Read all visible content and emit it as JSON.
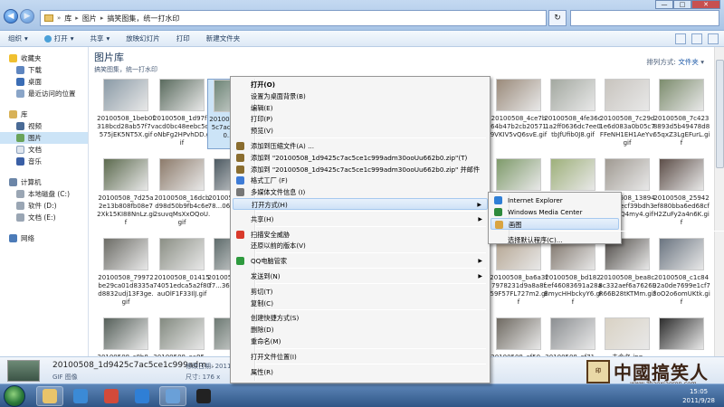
{
  "window": {
    "address": [
      "库",
      "图片",
      "搞笑图集，统一打水印"
    ],
    "controls": [
      "—",
      "□",
      "✕"
    ]
  },
  "toolbar": {
    "items": [
      "组织",
      "打开",
      "共享",
      "放映幻灯片",
      "打印",
      "新建文件夹"
    ]
  },
  "nav": {
    "favorites": {
      "label": "收藏夹",
      "items": [
        "下载",
        "桌面",
        "最近访问的位置"
      ]
    },
    "libraries": {
      "label": "库",
      "items": [
        "视频",
        "图片",
        "文档",
        "音乐"
      ]
    },
    "computer": {
      "label": "计算机",
      "items": [
        "本地磁盘 (C:)",
        "软件 (D:)",
        "文档 (E:)"
      ]
    },
    "network": {
      "label": "网络"
    }
  },
  "library": {
    "title": "图片库",
    "subtitle": "搞笑图集，统一打水印",
    "arrange_label": "排列方式:",
    "arrange_value": "文件夹"
  },
  "files": [
    {
      "name": "20100508_1beb0f318bcd28ab57f7v575jEK5NT5X.gif",
      "color": "#8a9aa6"
    },
    {
      "name": "20100508_1d97f9acd0bc48eebc5doNbFg2HPvhDD.gif",
      "color": "#5a6b5e"
    },
    {
      "name": "20100508_1d9425c7ac...9adm300...2b.gif",
      "color": "#6e8577"
    },
    {
      "name": "",
      "color": "#b89c86"
    },
    {
      "name": "",
      "color": "#7b8d96"
    },
    {
      "name": "20100508_4ce7b64b47b2cb205719VKIV5vQ6svE.gif",
      "color": "#9a8a7a"
    },
    {
      "name": "20100508_4fe36c1a2ff0636dc7ee0tbJfUfib0J8.gif",
      "color": "#a3a8a0"
    },
    {
      "name": "20100508_7c29d1e6d083a0b05c7FFeNH1EH1AeYv.gif",
      "color": "#c8c4be"
    },
    {
      "name": "20100508_7c4238893d5b49478d865qxZ3LgEFurL.gif",
      "color": "#7c8c6d"
    },
    {
      "name": "20100508_7d25a2e13b808fb08e72Xk15KI88NnLz.gif",
      "color": "#5c6a4e"
    },
    {
      "name": "20100508_16dcbd98d50b9fb4c6e2suvqMsXxOQoU.gif",
      "color": "#8d7b6b"
    },
    {
      "name": "20100508_...7f1b78...06aHE...1b.gif",
      "color": "#4d5a62"
    },
    {
      "name": "",
      "color": "#6a7d8a"
    },
    {
      "name": "",
      "color": "#909a8d"
    },
    {
      "name": "",
      "color": "#7e9a6a"
    },
    {
      "name": "",
      "color": "#9eb07a"
    },
    {
      "name": "20100508_13894d4aeaecf39bdh3Hj3Z9Q4my4.gif",
      "color": "#a09a92"
    },
    {
      "name": "20100508_25942ef880bba6ed68cfH2ZuFy2a4n6K.gif",
      "color": "#5d4e48"
    },
    {
      "name": "20100508_79972be29ca01d8335ad8832udj13F3ge.gif",
      "color": "#6c6c66"
    },
    {
      "name": "20100508_0141574051edca5a2f80auOlF1F33IlJ.gif",
      "color": "#8b8f85"
    },
    {
      "name": "20100508_...c905f7...36N01...w.gif",
      "color": "#5f6c6c"
    },
    {
      "name": "",
      "color": "#7a8b84"
    },
    {
      "name": "",
      "color": "#98a29a"
    },
    {
      "name": "20100508_ba6a3f7978231d9a8a8f59F57FL727m2.gif",
      "color": "#b3a38f"
    },
    {
      "name": "20100508_bd182cef46083691a28aBmycHHbckyY6.gif",
      "color": "#7d7369"
    },
    {
      "name": "20100508_bea8c8c332aef6a7626LR66B28tKTMm.gif",
      "color": "#4e4a46"
    },
    {
      "name": "20100508_c1c8492a0de7699e1cf73oO2o6omUKtk.gif",
      "color": "#6a7480"
    },
    {
      "name": "20100508_c8b8...",
      "color": "#56605a"
    },
    {
      "name": "20100508_ea95...",
      "color": "#838a80"
    },
    {
      "name": "",
      "color": "#6e7a74"
    },
    {
      "name": "",
      "color": "#8e968a"
    },
    {
      "name": "",
      "color": "#a6a6a0"
    },
    {
      "name": "20100508_ef50...",
      "color": "#6f6a62"
    },
    {
      "name": "20100508_ef71...",
      "color": "#8c8f92"
    },
    {
      "name": "未命名.jpg",
      "color": "#d9d2c4"
    },
    {
      "name": "",
      "color": "#2d2d2d"
    }
  ],
  "context_menu": {
    "items": [
      {
        "label": "打开(O)",
        "bold": true
      },
      {
        "label": "设置为桌面背景(B)"
      },
      {
        "label": "编辑(E)"
      },
      {
        "label": "打印(P)"
      },
      {
        "label": "预览(V)"
      },
      {
        "sep": true
      },
      {
        "label": "添加到压缩文件(A) ...",
        "icon": "#8a6d2f"
      },
      {
        "label": "添加到 \"20100508_1d9425c7ac5ce1c999adm30ooUu662b0.zip\"(T)",
        "icon": "#8a6d2f"
      },
      {
        "label": "添加到 \"20100508_1d9425c7ac5ce1c999adm30ooUu662b0.zip\" 并邮件",
        "icon": "#8a6d2f"
      },
      {
        "label": "格式工厂    (F)",
        "icon": "#3e7bd6"
      },
      {
        "label": "多媒体文件信息 (I)",
        "icon": "#777777"
      },
      {
        "label": "打开方式(H)",
        "submenu": true,
        "highlighted": true
      },
      {
        "sep": true
      },
      {
        "label": "共享(H)",
        "submenu": true
      },
      {
        "sep": true
      },
      {
        "label": "扫描安全威胁",
        "icon": "#d93a2b"
      },
      {
        "label": "还原以前的版本(V)"
      },
      {
        "sep": true
      },
      {
        "label": "QQ电脑管家",
        "submenu": true,
        "icon": "#2e9a3e"
      },
      {
        "sep": true
      },
      {
        "label": "发送到(N)",
        "submenu": true
      },
      {
        "sep": true
      },
      {
        "label": "剪切(T)"
      },
      {
        "label": "复制(C)"
      },
      {
        "sep": true
      },
      {
        "label": "创建快捷方式(S)"
      },
      {
        "label": "删除(D)"
      },
      {
        "label": "重命名(M)"
      },
      {
        "sep": true
      },
      {
        "label": "打开文件位置(I)"
      },
      {
        "sep": true
      },
      {
        "label": "属性(R)"
      }
    ]
  },
  "open_with_menu": {
    "items": [
      {
        "label": "Internet Explorer",
        "icon": "#2f7fd6"
      },
      {
        "label": "Windows Media Center",
        "icon": "#2d8a3c"
      },
      {
        "label": "画图",
        "icon": "#d9a441",
        "highlighted": true
      },
      {
        "sep": true
      },
      {
        "label": "选择默认程序(C)..."
      }
    ]
  },
  "details": {
    "name": "20100508_1d9425c7ac5ce1c999adm...",
    "type": "GIF 图像",
    "meta1": "修改日期: 2011",
    "meta2": "尺寸: 176 x"
  },
  "taskbar": {
    "apps": [
      {
        "name": "explorer",
        "color": "#e9c46a",
        "active": true
      },
      {
        "name": "security",
        "color": "#3b8ad6"
      },
      {
        "name": "chrome",
        "color": "#d24a3a"
      },
      {
        "name": "ie",
        "color": "#2f7fd6"
      },
      {
        "name": "explorer-window",
        "color": "#6aa0d8",
        "active": true
      },
      {
        "name": "qq",
        "color": "#222222"
      }
    ],
    "time": "15:05",
    "date": "2011/9/28"
  },
  "watermark": {
    "text": "中國搞笑人",
    "url": "www.zhaoxiaoren.com"
  },
  "colors": {
    "accent": "#1e395b",
    "selection": "#cce4f7",
    "menu_highlight": "#cfe2f7"
  }
}
